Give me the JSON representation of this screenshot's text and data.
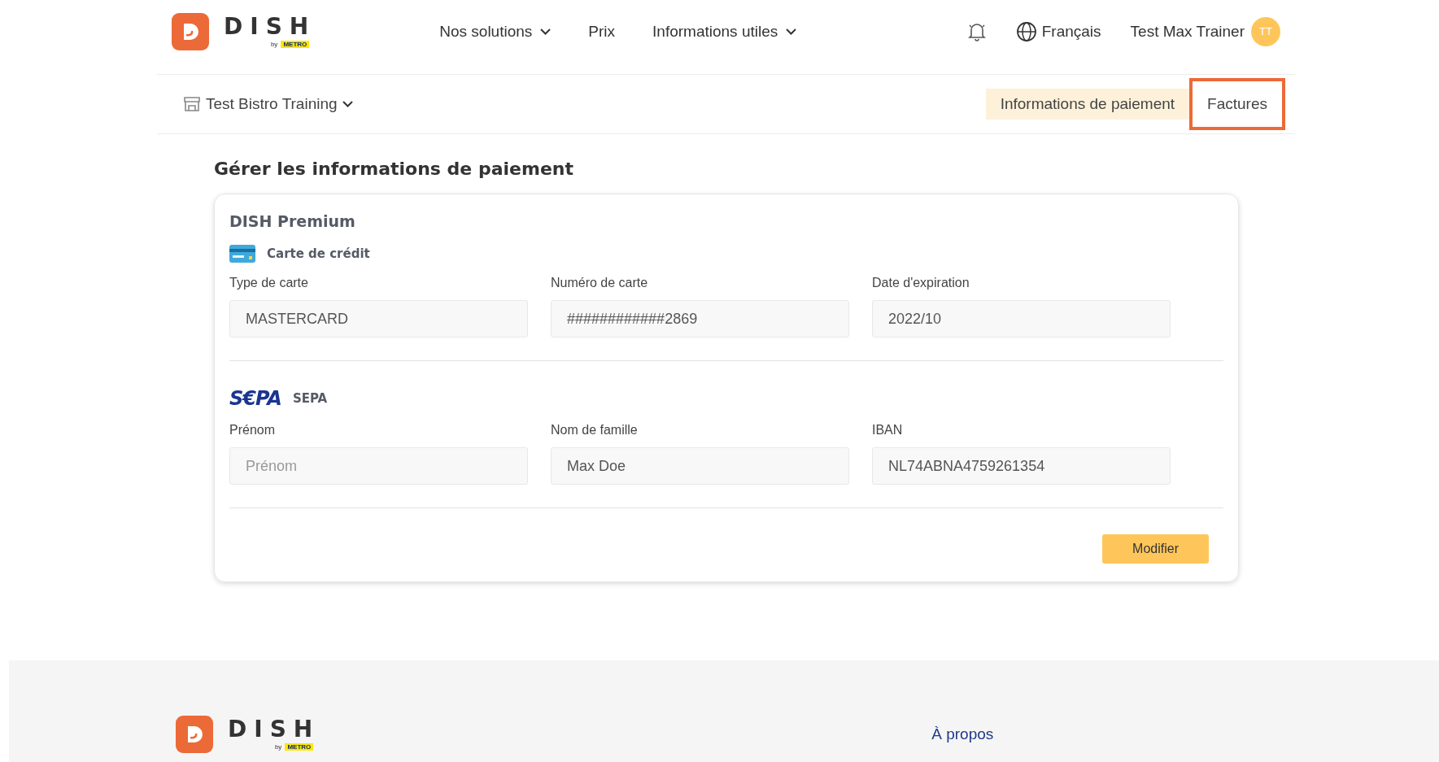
{
  "header": {
    "logo": {
      "word": "DISH",
      "by": "by",
      "brand": "METRO"
    },
    "nav": [
      {
        "label": "Nos solutions",
        "dropdown": true
      },
      {
        "label": "Prix",
        "dropdown": false
      },
      {
        "label": "Informations utiles",
        "dropdown": true
      }
    ],
    "language": "Français",
    "user": {
      "name": "Test Max Trainer",
      "initials": "TT"
    }
  },
  "subbar": {
    "restaurant": "Test Bistro Training",
    "tabs": [
      {
        "label": "Informations de paiement",
        "selected": true,
        "highlighted": false
      },
      {
        "label": "Factures",
        "selected": false,
        "highlighted": true
      }
    ]
  },
  "page_title": "Gérer les informations de paiement",
  "card": {
    "plan": "DISH Premium",
    "sections": [
      {
        "kind": "card",
        "title": "Carte de crédit",
        "fields": [
          {
            "label": "Type de carte",
            "value": "MASTERCARD"
          },
          {
            "label": "Numéro de carte",
            "value": "############2869"
          },
          {
            "label": "Date d'expiration",
            "value": "2022/10"
          }
        ]
      },
      {
        "kind": "sepa",
        "logo": "S€PA",
        "title": "SEPA",
        "fields": [
          {
            "label": "Prénom",
            "placeholder": "Prénom"
          },
          {
            "label": "Nom de famille",
            "value": "Max Doe"
          },
          {
            "label": "IBAN",
            "value": "NL74ABNA4759261354"
          }
        ]
      }
    ],
    "button": "Modifier"
  },
  "footer": {
    "logo": {
      "word": "DISH",
      "by": "by",
      "brand": "METRO"
    },
    "links": [
      "À propos"
    ]
  }
}
